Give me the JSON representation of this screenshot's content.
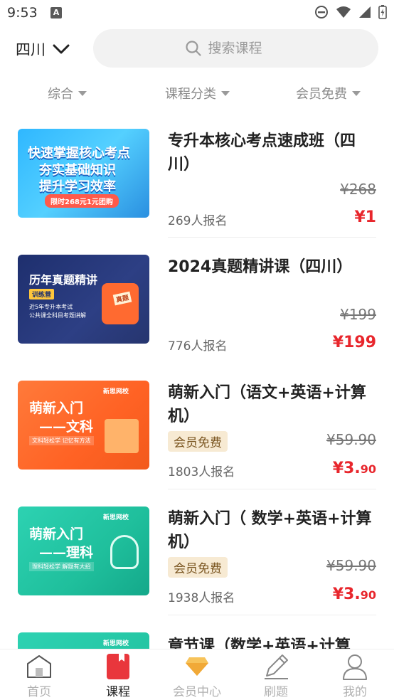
{
  "status": {
    "time": "9:53",
    "a_icon_letter": "A"
  },
  "header": {
    "region": "四川",
    "search_placeholder": "搜索课程"
  },
  "filters": [
    {
      "label": "综合"
    },
    {
      "label": "课程分类"
    },
    {
      "label": "会员免费"
    }
  ],
  "courses": [
    {
      "title": "专升本核心考点速成班（四川）",
      "thumb_lines": [
        "快速掌握核心考点",
        "夯实基础知识",
        "提升学习效率"
      ],
      "thumb_tag": "限时268元1元团购",
      "original_price": "¥268",
      "enrolled": "269人报名",
      "price_main": "¥1",
      "price_decimals": "",
      "vip_badge": ""
    },
    {
      "title": "2024真题精讲课（四川）",
      "thumb_lines": [
        "历年真题精讲",
        "训练营",
        "近5年专升本考试",
        "公共课全科目考题讲解"
      ],
      "thumb_tag": "真题",
      "original_price": "¥199",
      "enrolled": "776人报名",
      "price_main": "¥199",
      "price_decimals": "",
      "vip_badge": ""
    },
    {
      "title": "萌新入门（语文+英语+计算机）",
      "thumb_lines": [
        "萌新入门",
        "——文科",
        "文科轻松学 记忆有方法"
      ],
      "thumb_tag": "新思网校",
      "original_price": "¥59.90",
      "enrolled": "1803人报名",
      "price_main": "¥3.",
      "price_decimals": "90",
      "vip_badge": "会员免费"
    },
    {
      "title": "萌新入门（ 数学+英语+计算机）",
      "thumb_lines": [
        "萌新入门",
        "——理科",
        "理科轻松学 解题有大招"
      ],
      "thumb_tag": "新思网校",
      "original_price": "¥59.90",
      "enrolled": "1938人报名",
      "price_main": "¥3.",
      "price_decimals": "90",
      "vip_badge": "会员免费"
    },
    {
      "title": "章节课（数学+英语+计算",
      "thumb_tag": "新思网校"
    }
  ],
  "bottom_nav": [
    {
      "label": "首页",
      "icon": "home-icon",
      "active": false
    },
    {
      "label": "课程",
      "icon": "book-icon",
      "active": true
    },
    {
      "label": "会员中心",
      "icon": "diamond-icon",
      "active": false
    },
    {
      "label": "刷题",
      "icon": "pencil-icon",
      "active": false
    },
    {
      "label": "我的",
      "icon": "user-icon",
      "active": false
    }
  ],
  "colors": {
    "price_red": "#e8262c",
    "vip_badge_bg": "#f7ead3",
    "active_nav": "#e9363c"
  }
}
